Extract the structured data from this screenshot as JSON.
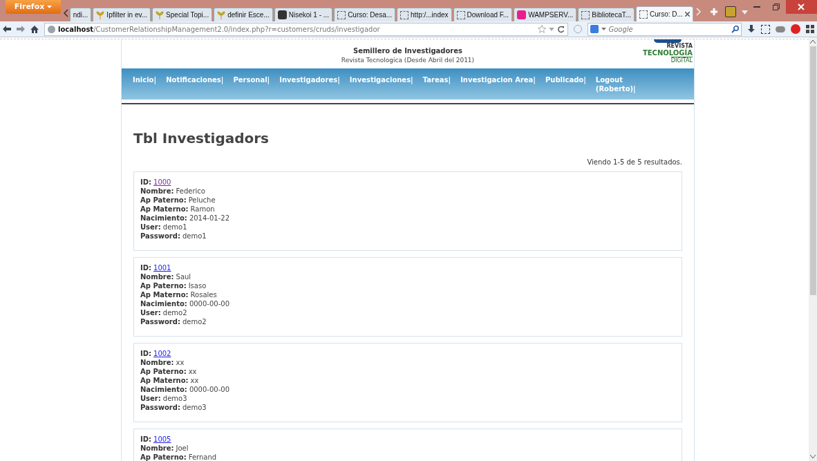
{
  "browser": {
    "menu_button": "Firefox",
    "tabs": [
      {
        "title": "ndi...",
        "kind": "partial",
        "selected": false
      },
      {
        "title": "Ipfilter in ev...",
        "kind": "leaf",
        "selected": false
      },
      {
        "title": "Special Topi...",
        "kind": "leaf",
        "selected": false
      },
      {
        "title": "definir Esce...",
        "kind": "leaf",
        "selected": false
      },
      {
        "title": "Nisekoi 1 - ...",
        "kind": "dark",
        "selected": false
      },
      {
        "title": "Curso: Desa...",
        "kind": "blank",
        "selected": false
      },
      {
        "title": "http:/...index",
        "kind": "blank",
        "selected": false
      },
      {
        "title": "Download F...",
        "kind": "blank",
        "selected": false
      },
      {
        "title": "WAMPSERV...",
        "kind": "pink",
        "selected": false
      },
      {
        "title": "BibliotecaT...",
        "kind": "blank",
        "selected": false
      },
      {
        "title": "Curso: D...",
        "kind": "blank",
        "selected": true
      }
    ],
    "url_host": "localhost",
    "url_path": "/CustomerRelationshipManagement2.0/index.php?r=customers/cruds/investigador",
    "search_placeholder": "Google"
  },
  "site": {
    "title": "Semillero de Investigadores",
    "subtitle": "Revista Tecnologica (Desde Abril del 2011)",
    "logo": {
      "top": "REVISTA",
      "main": "TECNOLOGÍA",
      "bottom": "DIGITAL"
    },
    "nav": [
      "Inicio|",
      "Notificaciones|",
      "Personal|",
      "Investigadores|",
      "Investigaciones|",
      "Tareas|",
      "Investigacion Area|",
      "Publicado|",
      "Logout (Roberto)|"
    ]
  },
  "page": {
    "heading": "Tbl Investigadors",
    "summary": "Viendo 1-5 de 5 resultados.",
    "records": [
      {
        "visited": true,
        "fields": [
          {
            "label": "ID:",
            "value": "1000"
          },
          {
            "label": "Nombre:",
            "value": "Federico"
          },
          {
            "label": "Ap Paterno:",
            "value": "Peluche"
          },
          {
            "label": "Ap Materno:",
            "value": "Ramon"
          },
          {
            "label": "Nacimiento:",
            "value": "2014-01-22"
          },
          {
            "label": "User:",
            "value": "demo1"
          },
          {
            "label": "Password:",
            "value": "demo1"
          }
        ]
      },
      {
        "visited": false,
        "fields": [
          {
            "label": "ID:",
            "value": "1001"
          },
          {
            "label": "Nombre:",
            "value": "Saul"
          },
          {
            "label": "Ap Paterno:",
            "value": "Isaso"
          },
          {
            "label": "Ap Materno:",
            "value": "Rosales"
          },
          {
            "label": "Nacimiento:",
            "value": "0000-00-00"
          },
          {
            "label": "User:",
            "value": "demo2"
          },
          {
            "label": "Password:",
            "value": "demo2"
          }
        ]
      },
      {
        "visited": false,
        "fields": [
          {
            "label": "ID:",
            "value": "1002"
          },
          {
            "label": "Nombre:",
            "value": "xx"
          },
          {
            "label": "Ap Paterno:",
            "value": "xx"
          },
          {
            "label": "Ap Materno:",
            "value": "xx"
          },
          {
            "label": "Nacimiento:",
            "value": "0000-00-00"
          },
          {
            "label": "User:",
            "value": "demo3"
          },
          {
            "label": "Password:",
            "value": "demo3"
          }
        ]
      },
      {
        "visited": false,
        "fields": [
          {
            "label": "ID:",
            "value": "1005"
          },
          {
            "label": "Nombre:",
            "value": "Joel"
          },
          {
            "label": "Ap Paterno:",
            "value": "Fernand"
          }
        ]
      }
    ]
  }
}
